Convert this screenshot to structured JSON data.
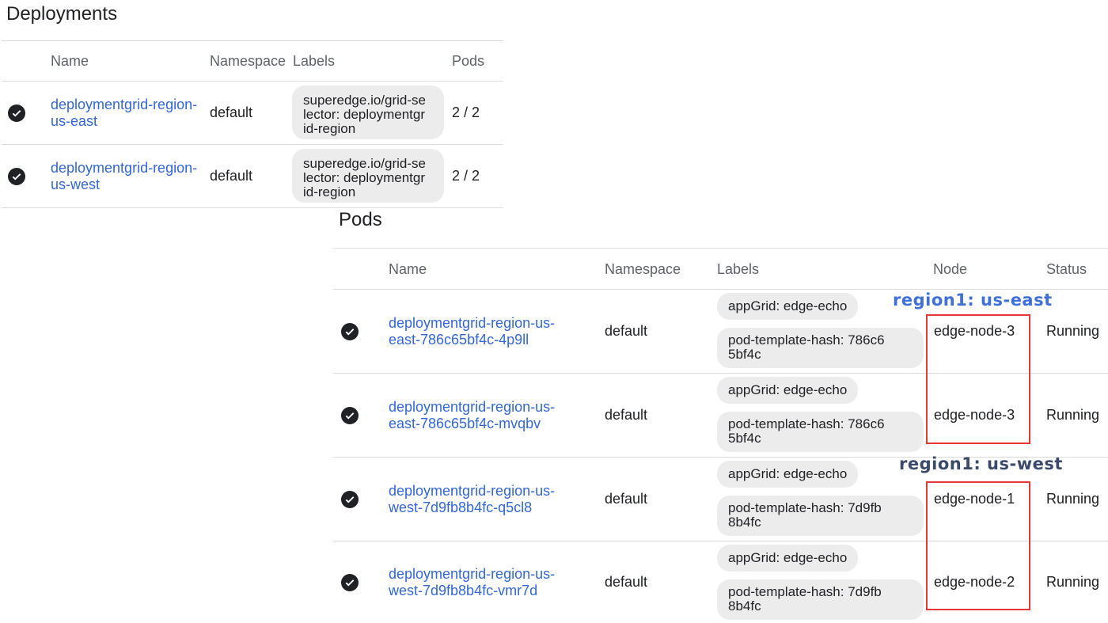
{
  "deployments": {
    "title": "Deployments",
    "columns": {
      "name": "Name",
      "namespace": "Namespace",
      "labels": "Labels",
      "pods": "Pods"
    },
    "rows": [
      {
        "status_icon": "check-circle-icon",
        "name_lines": [
          "deploymentgrid-region-",
          "us-east"
        ],
        "namespace": "default",
        "label_lines": [
          "superedge.io/grid-se",
          "lector: deploymentgr",
          "id-region"
        ],
        "pods": "2 / 2"
      },
      {
        "status_icon": "check-circle-icon",
        "name_lines": [
          "deploymentgrid-region-",
          "us-west"
        ],
        "namespace": "default",
        "label_lines": [
          "superedge.io/grid-se",
          "lector: deploymentgr",
          "id-region"
        ],
        "pods": "2 / 2"
      }
    ]
  },
  "pods": {
    "title": "Pods",
    "columns": {
      "name": "Name",
      "namespace": "Namespace",
      "labels": "Labels",
      "node": "Node",
      "status": "Status"
    },
    "rows": [
      {
        "status_icon": "check-circle-icon",
        "name_lines": [
          "deploymentgrid-region-us-",
          "east-786c65bf4c-4p9ll"
        ],
        "namespace": "default",
        "label_app": "appGrid: edge-echo",
        "label_hash_lines": [
          "pod-template-hash: 786c6",
          "5bf4c"
        ],
        "node": "edge-node-3",
        "status": "Running"
      },
      {
        "status_icon": "check-circle-icon",
        "name_lines": [
          "deploymentgrid-region-us-",
          "east-786c65bf4c-mvqbv"
        ],
        "namespace": "default",
        "label_app": "appGrid: edge-echo",
        "label_hash_lines": [
          "pod-template-hash: 786c6",
          "5bf4c"
        ],
        "node": "edge-node-3",
        "status": "Running"
      },
      {
        "status_icon": "check-circle-icon",
        "name_lines": [
          "deploymentgrid-region-us-",
          "west-7d9fb8b4fc-q5cl8"
        ],
        "namespace": "default",
        "label_app": "appGrid: edge-echo",
        "label_hash_lines": [
          "pod-template-hash: 7d9fb",
          "8b4fc"
        ],
        "node": "edge-node-1",
        "status": "Running"
      },
      {
        "status_icon": "check-circle-icon",
        "name_lines": [
          "deploymentgrid-region-us-",
          "west-7d9fb8b4fc-vmr7d"
        ],
        "namespace": "default",
        "label_app": "appGrid: edge-echo",
        "label_hash_lines": [
          "pod-template-hash: 7d9fb",
          "8b4fc"
        ],
        "node": "edge-node-2",
        "status": "Running"
      }
    ]
  },
  "annotations": [
    {
      "text": "region1: us-east",
      "color": "#3f6fd8"
    },
    {
      "text": "region1: us-west",
      "color": "#3b4a6b"
    }
  ],
  "colors": {
    "link": "#3367d6",
    "chip_bg": "#ececec",
    "highlight_box": "#e53935",
    "status_ok": "#202124"
  }
}
